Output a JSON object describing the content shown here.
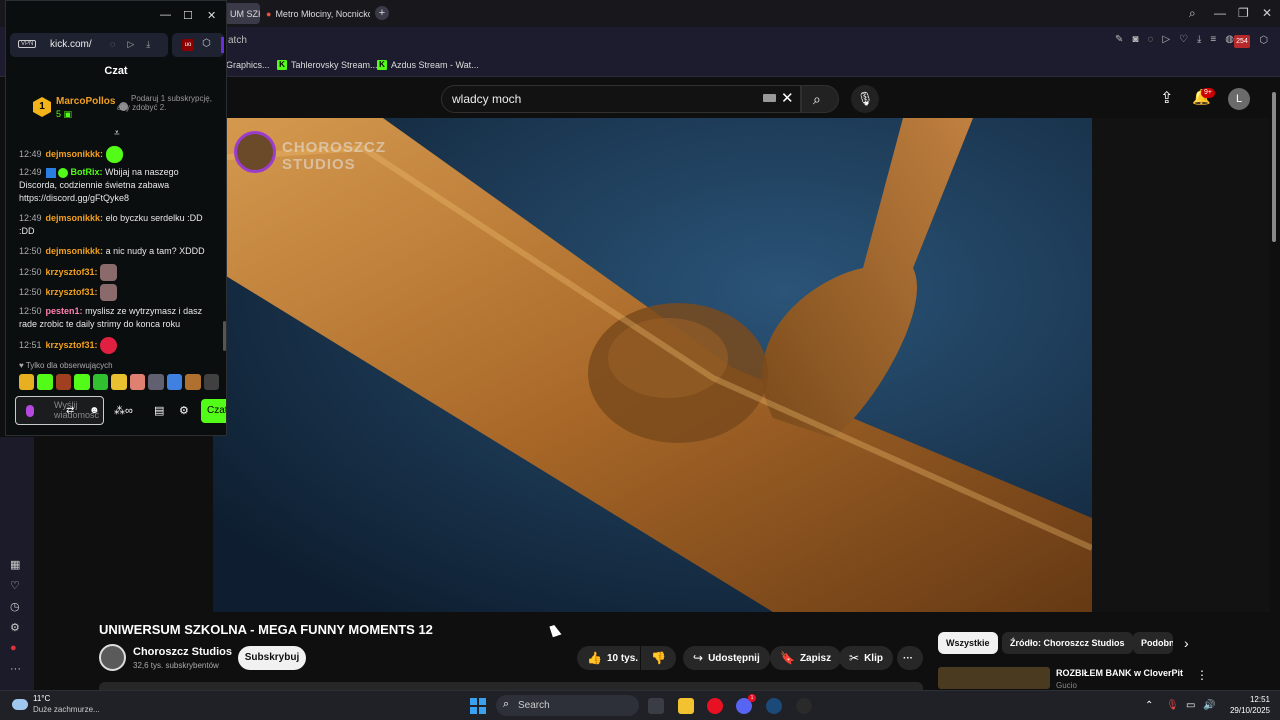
{
  "browser": {
    "tabs": [
      {
        "label": "UM SZK"
      },
      {
        "label": "Metro Młociny, Nocnicko"
      }
    ],
    "new_tab_icon": "plus-icon",
    "url_fragment": "atch",
    "ext_badge": "254",
    "bookmarks": [
      {
        "label": "Graphics..."
      },
      {
        "label": "Tahlerovsky Stream..."
      },
      {
        "label": "Azdus Stream - Wat..."
      }
    ]
  },
  "youtube": {
    "search_value": "wladcy moch",
    "notifications_badge": "9+",
    "avatar_letter": "L",
    "watermark_text": "CHOROSZCZ STUDIOS",
    "video_title": "UNIWERSUM SZKOLNA - MEGA FUNNY MOMENTS 12",
    "channel_name": "Choroszcz Studios",
    "channel_subs": "32,6 tys. subskrybentów",
    "subscribe_label": "Subskrybuj",
    "likes_label": "10 tys.",
    "share_label": "Udostępnij",
    "save_label": "Zapisz",
    "clip_label": "Klip",
    "more_label": "···",
    "chips": [
      {
        "label": "Wszystkie"
      },
      {
        "label": "Źródło: Choroszcz Studios"
      },
      {
        "label": "Podobne"
      }
    ],
    "recommendation": {
      "title": "ROZBIŁEM BANK w CloverPit",
      "subtitle": "Gucio"
    }
  },
  "kick": {
    "vpn_label": "VPN",
    "url": "kick.com/",
    "ublock_label": "uo",
    "chat_title": "Czat",
    "top_gifter": {
      "rank": "1",
      "name": "MarcoPollos",
      "count": "5"
    },
    "promo": "Podaruj 1 subskrypcję, aby zdobyć 2.",
    "messages": [
      {
        "time": "12:49",
        "user": "dejmsonikkk:",
        "text": ""
      },
      {
        "time": "12:49",
        "user": "BotRix:",
        "text": "Wbijaj na naszego Discorda, codziennie świetna zabawa https://discord.gg/gFtQyke8"
      },
      {
        "time": "12:49",
        "user": "dejmsonikkk:",
        "text": "elo byczku serdelku :DD :DD"
      },
      {
        "time": "12:50",
        "user": "dejmsonikkk:",
        "text": "a nic nudy a tam? XDDD"
      },
      {
        "time": "12:50",
        "user": "krzysztof31:",
        "text": ""
      },
      {
        "time": "12:50",
        "user": "krzysztof31:",
        "text": ""
      },
      {
        "time": "12:50",
        "user": "pesten1:",
        "text": "myslisz ze wytrzymasz i dasz rade zrobic te daily strimy do konca roku"
      },
      {
        "time": "12:51",
        "user": "krzysztof31:",
        "text": ""
      }
    ],
    "followers_only": "Tylko dla obserwujących",
    "input_placeholder": "Wyślij wiadomość",
    "send_label": "Czat",
    "colors": {
      "accent": "#53fc18",
      "gifter": "#f0a020",
      "bot": "#53fc18",
      "pesten": "#ff7eb0",
      "user": "#f0a020"
    }
  },
  "taskbar": {
    "temperature": "11°C",
    "condition": "Duże zachmurze...",
    "search_label": "Search",
    "discord_badge": "1",
    "time": "12:51",
    "date": "29/10/2025"
  }
}
